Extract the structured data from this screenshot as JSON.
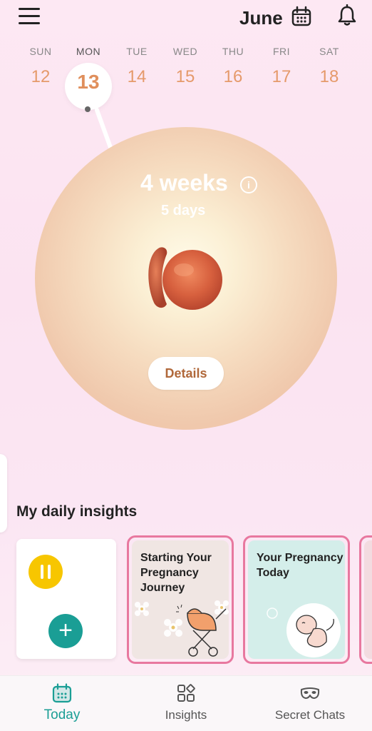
{
  "header": {
    "month": "June",
    "icons": [
      "menu-icon",
      "calendar-icon",
      "bell-icon"
    ]
  },
  "week": [
    {
      "name": "SUN",
      "date": "12"
    },
    {
      "name": "MON",
      "date": "13"
    },
    {
      "name": "TUE",
      "date": "14"
    },
    {
      "name": "WED",
      "date": "15"
    },
    {
      "name": "THU",
      "date": "16"
    },
    {
      "name": "FRI",
      "date": "17"
    },
    {
      "name": "SAT",
      "date": "18"
    }
  ],
  "selected_day": "13",
  "pregnancy": {
    "weeks": "4 weeks",
    "days": "5 days",
    "details_label": "Details"
  },
  "insights": {
    "title": "My daily insights",
    "cards": [
      {
        "title": "Starting Your Pregnancy Journey"
      },
      {
        "title": "Your Pregnancy Today"
      }
    ]
  },
  "nav": [
    {
      "label": "Today",
      "icon": "calendar-icon",
      "active": true
    },
    {
      "label": "Insights",
      "icon": "grid-icon",
      "active": false
    },
    {
      "label": "Secret Chats",
      "icon": "mask-icon",
      "active": false
    }
  ],
  "colors": {
    "accent": "#1a9e95",
    "date": "#e59a6b",
    "story_border": "#e8789f",
    "pause": "#f7c600"
  }
}
